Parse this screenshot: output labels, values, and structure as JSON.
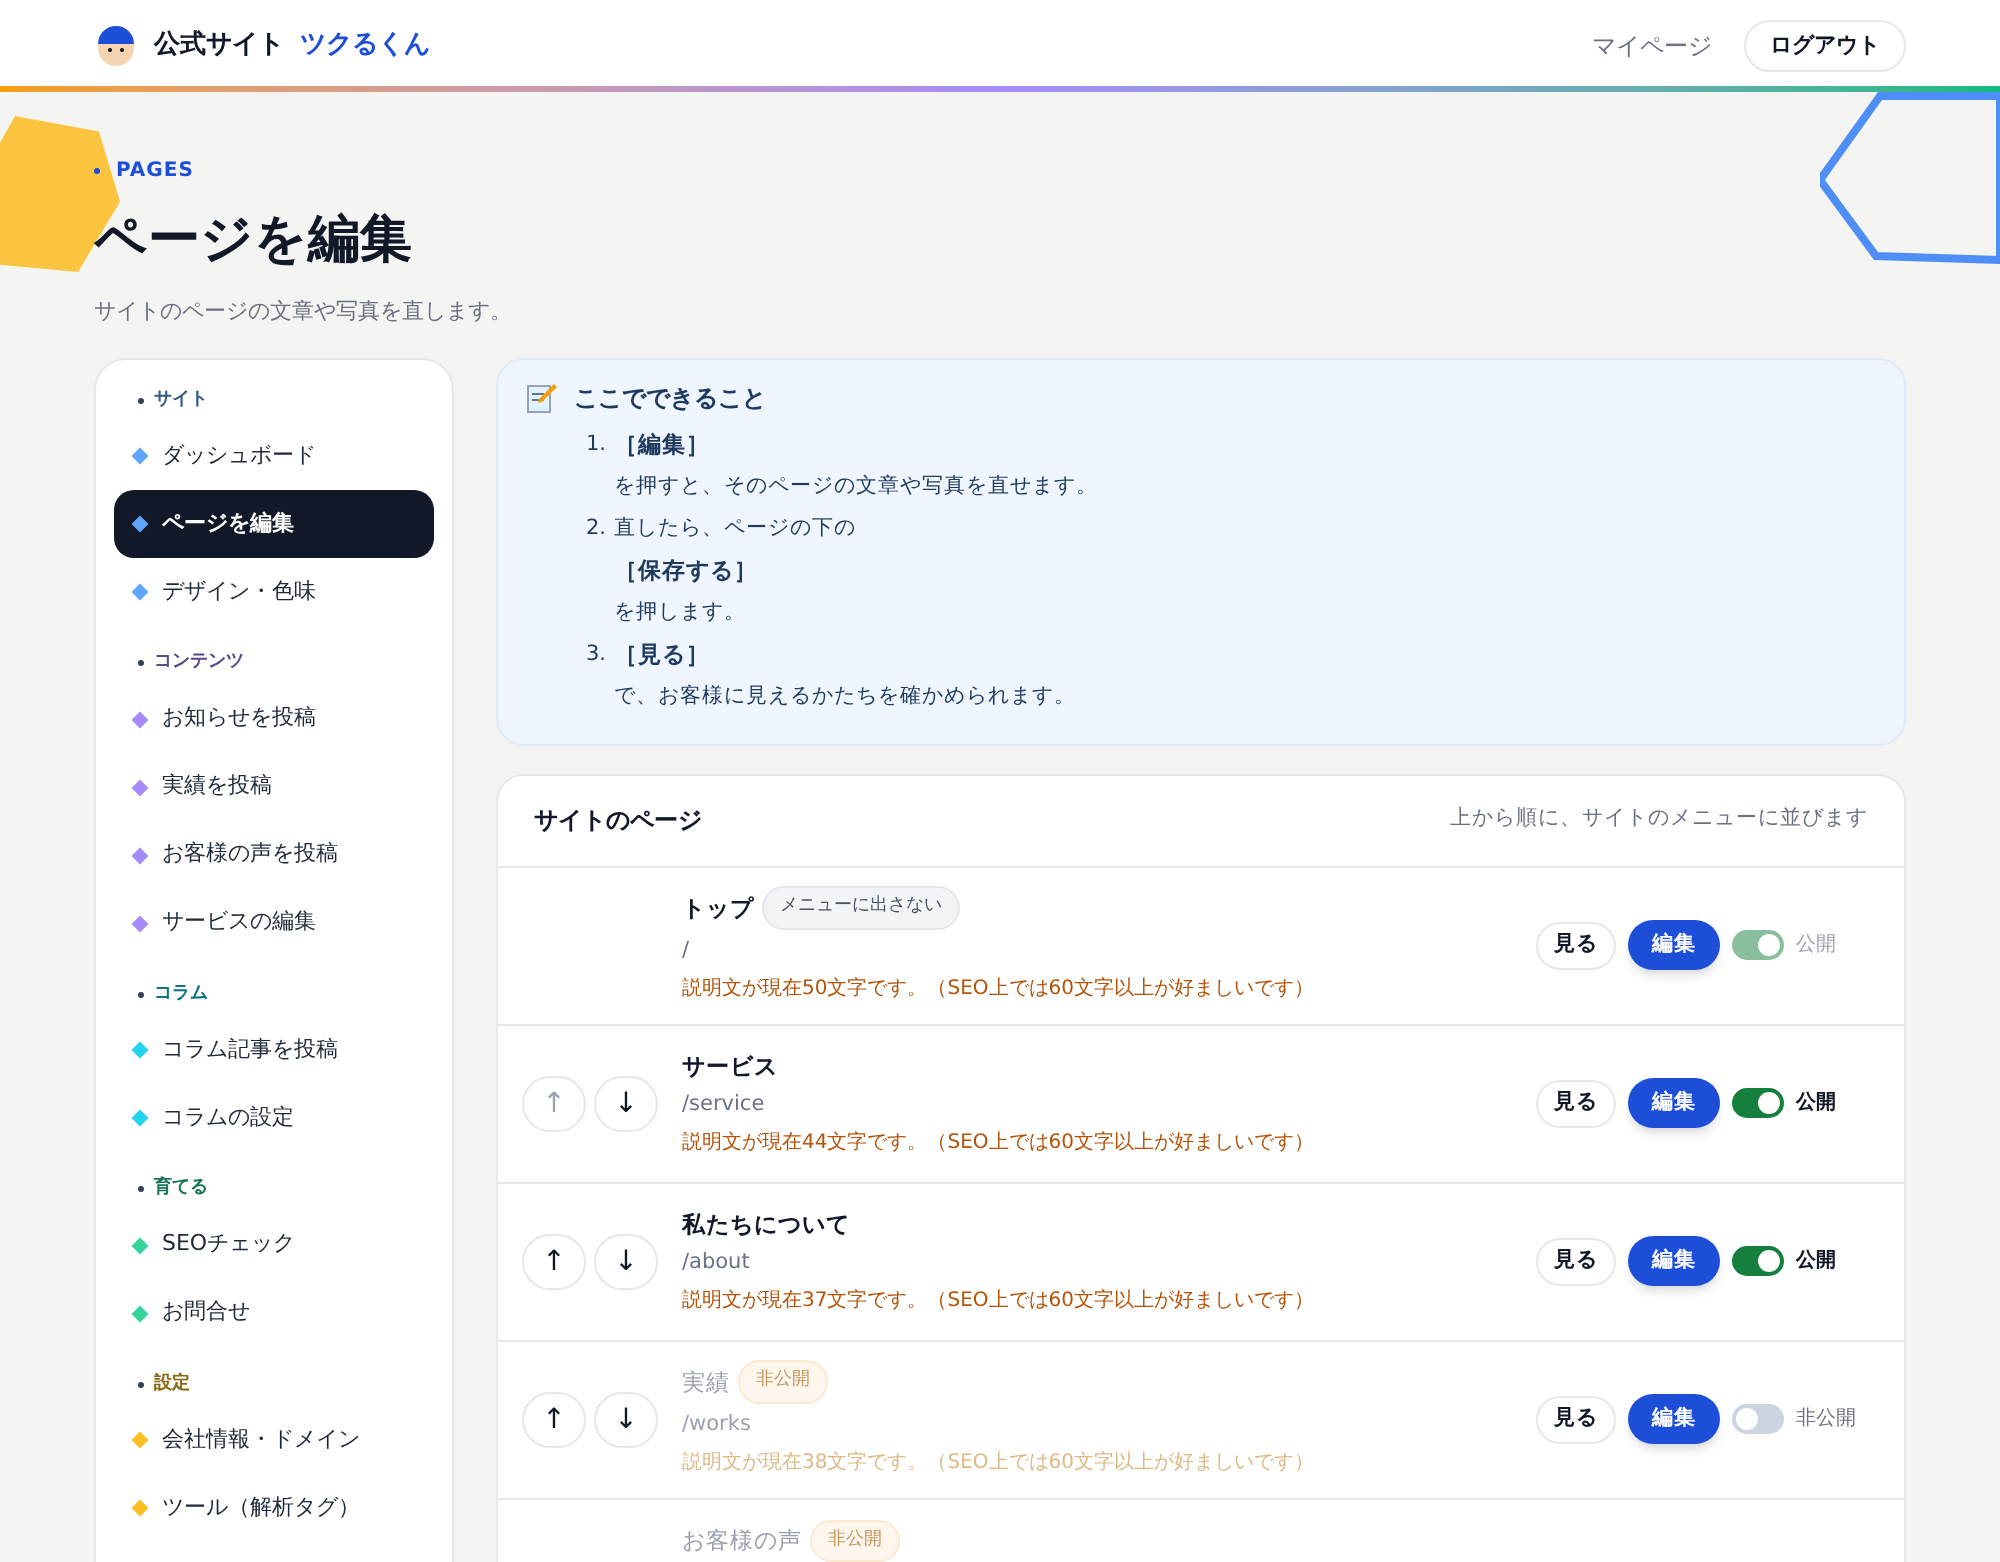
{
  "header": {
    "site_label": "公式サイト",
    "site_name": "ツクるくん",
    "links": [
      {
        "label": "マイページ",
        "kind": "link"
      },
      {
        "label": "ログアウト",
        "kind": "button"
      }
    ]
  },
  "hero": {
    "eyebrow": "PAGES",
    "title": "ページを編集",
    "subtitle": "サイトのページの文章や写真を直します。"
  },
  "sidebar": {
    "groups": [
      {
        "label": "サイト",
        "color": "#60a5fa",
        "items": [
          {
            "label": "ダッシュボード",
            "selected": false
          },
          {
            "label": "ページを編集",
            "selected": true
          },
          {
            "label": "デザイン・色味",
            "selected": false
          }
        ]
      },
      {
        "label": "コンテンツ",
        "color": "#a78bfa",
        "items": [
          {
            "label": "お知らせを投稿",
            "selected": false
          },
          {
            "label": "実績を投稿",
            "selected": false
          },
          {
            "label": "お客様の声を投稿",
            "selected": false
          },
          {
            "label": "サービスの編集",
            "selected": false
          }
        ]
      },
      {
        "label": "コラム",
        "color": "#22d3ee",
        "items": [
          {
            "label": "コラム記事を投稿",
            "selected": false
          },
          {
            "label": "コラムの設定",
            "selected": false
          }
        ]
      },
      {
        "label": "育てる",
        "color": "#34d399",
        "items": [
          {
            "label": "SEOチェック",
            "selected": false
          },
          {
            "label": "お問合せ",
            "selected": false
          }
        ]
      },
      {
        "label": "設定",
        "color": "#fbbf24",
        "items": [
          {
            "label": "会社情報・ドメイン",
            "selected": false
          },
          {
            "label": "ツール（解析タグ）",
            "selected": false
          }
        ]
      }
    ]
  },
  "help": {
    "title": "ここでできること",
    "steps": [
      {
        "number": "1.",
        "action": "［編集］",
        "after": "を押すと、そのページの文章や写真を直せます。"
      },
      {
        "number": "2.",
        "lead": "直したら、ページの下の",
        "action": "［保存する］",
        "after": "を押します。"
      },
      {
        "number": "3.",
        "action": "［見る］",
        "after": "で、お客様に見えるかたちを確かめられます。"
      }
    ]
  },
  "pages": {
    "title": "サイトのページ",
    "note": "上から順に、サイトのメニューに並びます",
    "rows": [
      {
        "name": "トップ",
        "badge": {
          "label": "メニューに出さない",
          "kind": "muted"
        },
        "path": "/",
        "seo": "説明文が現在50文字です。（SEO上では60文字以上が好ましいです）",
        "movable": false,
        "published": true,
        "view": "見る",
        "edit": "編集",
        "toggle": {
          "on": true,
          "disabled": true,
          "label": "公開"
        }
      },
      {
        "name": "サービス",
        "path": "/service",
        "seo": "説明文が現在44文字です。（SEO上では60文字以上が好ましいです）",
        "movable": true,
        "up": {
          "label": "↑",
          "disabled": true
        },
        "down": {
          "label": "↓",
          "disabled": false
        },
        "published": true,
        "view": "見る",
        "edit": "編集",
        "toggle": {
          "on": true,
          "disabled": false,
          "label": "公開"
        }
      },
      {
        "name": "私たちについて",
        "path": "/about",
        "seo": "説明文が現在37文字です。（SEO上では60文字以上が好ましいです）",
        "movable": true,
        "up": {
          "label": "↑",
          "disabled": false
        },
        "down": {
          "label": "↓",
          "disabled": false
        },
        "published": true,
        "view": "見る",
        "edit": "編集",
        "toggle": {
          "on": true,
          "disabled": false,
          "label": "公開"
        }
      },
      {
        "name": "実績",
        "badge": {
          "label": "非公開",
          "kind": "private"
        },
        "path": "/works",
        "seo": "説明文が現在38文字です。（SEO上では60文字以上が好ましいです）",
        "movable": true,
        "up": {
          "label": "↑",
          "disabled": false
        },
        "down": {
          "label": "↓",
          "disabled": false
        },
        "published": false,
        "view": "見る",
        "edit": "編集",
        "toggle": {
          "on": false,
          "disabled": false,
          "label": "非公開"
        }
      },
      {
        "name": "お客様の声",
        "badge": {
          "label": "非公開",
          "kind": "private"
        },
        "movable": false,
        "published": false
      }
    ]
  }
}
